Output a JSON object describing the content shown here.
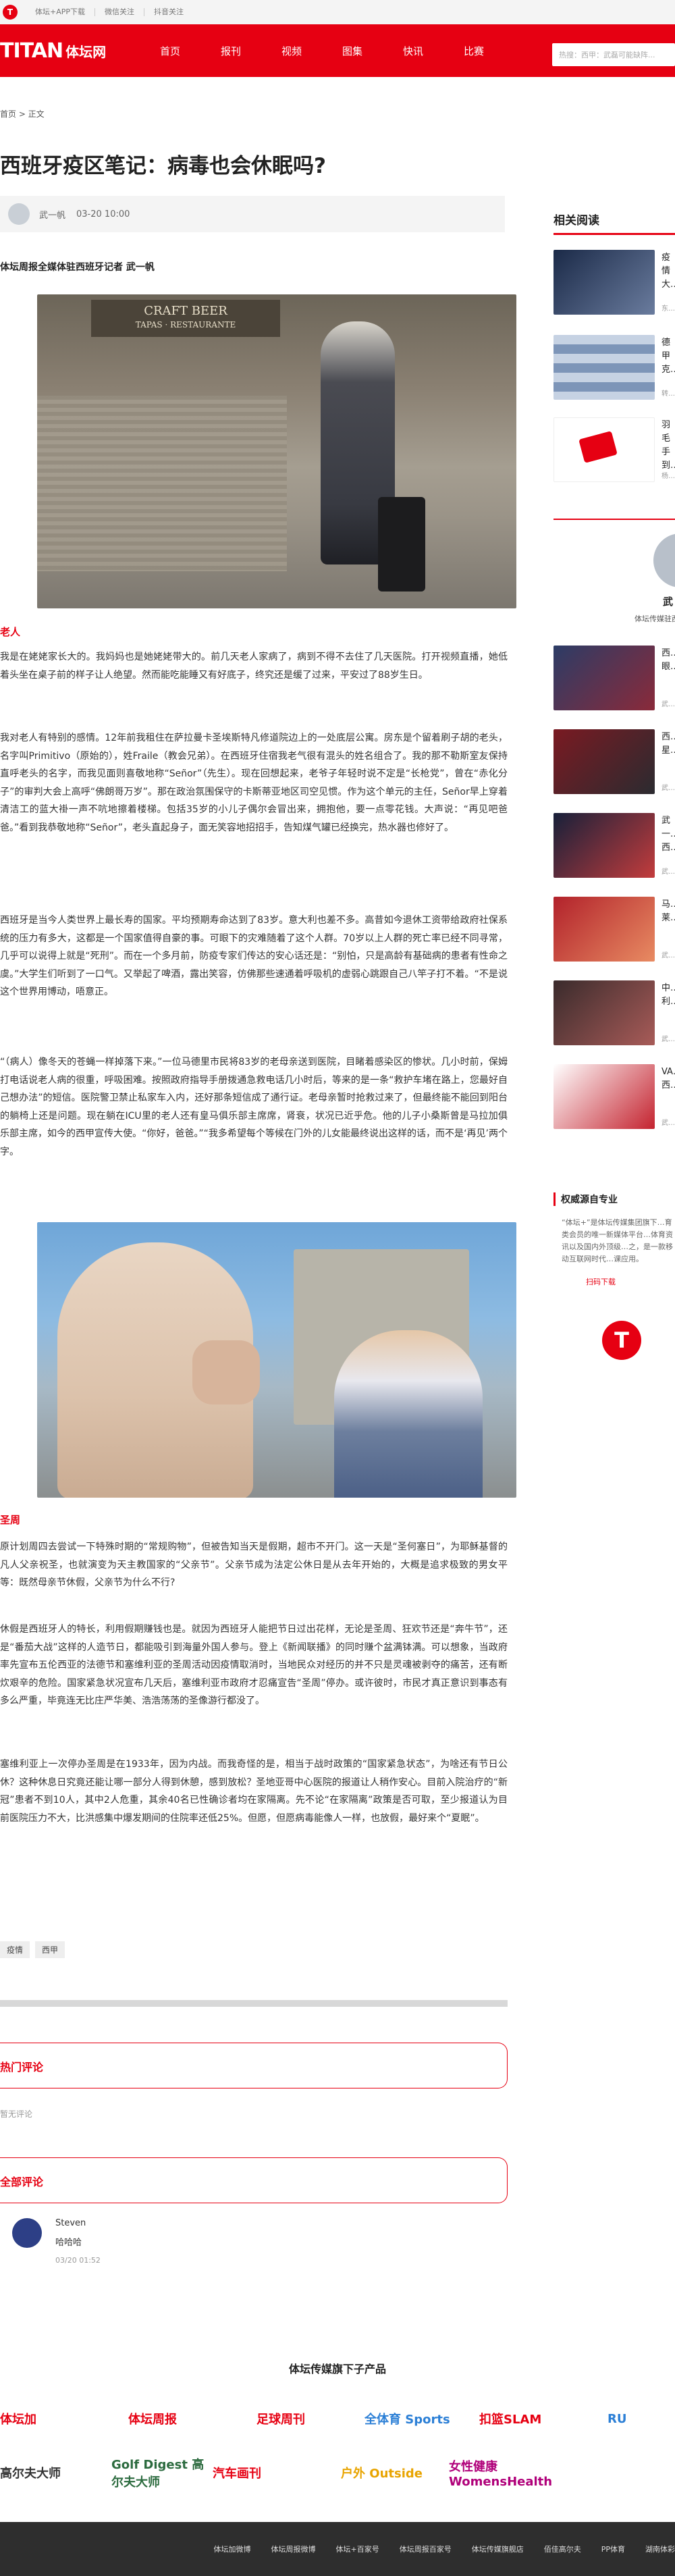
{
  "topbar": {
    "links": [
      "体坛+APP下载",
      "微信关注",
      "抖音关注"
    ]
  },
  "nav": {
    "brand": "TITAN",
    "brand_cn": "体坛网",
    "items": [
      "首页",
      "报刊",
      "视频",
      "图集",
      "快讯",
      "比赛"
    ],
    "search_placeholder": "热搜：西甲：武磊可能缺阵..."
  },
  "breadcrumb": "首页 > 正文",
  "article": {
    "title": "西班牙疫区笔记：病毒也会休眠吗?",
    "author": "武一帆",
    "date": "03-20 10:00",
    "lead": "体坛周报全媒体驻西班牙记者 武一帆",
    "photo1_sign": "CRAFT BEER",
    "photo1_sign2": "TAPAS · RESTAURANTE",
    "sections": [
      {
        "heading": "老人",
        "paragraphs": [
          "我是在姥姥家长大的。我妈妈也是她姥姥带大的。前几天老人家病了，病到不得不去住了几天医院。打开视频直播，她低着头坐在桌子前的样子让人绝望。然而能吃能睡又有好底子，终究还是缓了过来，平安过了88岁生日。",
          "我对老人有特别的感情。12年前我租住在萨拉曼卡圣埃斯特凡修道院边上的一处底层公寓。房东是个留着刷子胡的老头，名字叫Primitivo（原始的），姓Fraile（教会兄弟）。在西班牙住宿我老气很有混头的姓名组合了。我的那不勒斯室友保持直呼老头的名字，而我见面则喜敬地称“Señor”（先生）。现在回想起来，老爷子年轻时说不定是“长枪党”，曾在“赤化分子”的审判大会上高呼“佛朗哥万岁”。那在政治氛围保守的卡斯蒂亚地区司空见惯。作为这个单元的主任，Señor早上穿着清洁工的蓝大褂一声不吭地擦着楼梯。包括35岁的小儿子偶尔会冒出来，拥抱他，要一点零花钱。大声说：“再见吧爸爸。”看到我恭敬地称“Señor”，老头直起身子，面无笑容地招招手，告知煤气罐已经换完，热水器也修好了。",
          "西班牙是当今人类世界上最长寿的国家。平均预期寿命达到了83岁。意大利也差不多。高昔如今退休工资带给政府社保系统的压力有多大，这都是一个国家值得自豪的事。可眼下的灾难随着了这个人群。70岁以上人群的死亡率已经不同寻常，几乎可以说得上就是“死刑”。而在一个多月前，防疫专家们传达的安心话还是：“别怕，只是高龄有基础病的患者有性命之虞。”大学生们听到了一口气。又举起了啤酒，露出笑容，仿佛那些速通着呼吸机的虚弱心跳跟自己八竿子打不着。“不是说这个世界用博动，唔意正。",
          "“（病人）像冬天的苍蝇一样掉落下来。”一位马德里市民将83岁的老母亲送到医院，目睹着感染区的惨状。几小时前，保姆打电话说老人病的很重，呼吸困难。按照政府指导手册拨通急救电话几小时后，等来的是一条“救护车堵在路上，您最好自己想办法”的短信。医院警卫禁止私家车入内，还好那条短信成了通行证。老母亲暂时抢救过来了，但最终能不能回到阳台的躺椅上还是问题。现在躺在ICU里的老人还有皇马俱乐部主席席，肾衰，状况已近乎危。他的儿子小桑斯曾是马拉加俱乐部主席，如今的西甲宣传大使。“你好，爸爸。”“我多希望每个等候在门外的儿女能最终说出这样的话，而不是‘再见’两个字。"
        ]
      },
      {
        "heading": "圣周",
        "paragraphs": [
          "原计划周四去尝试一下特殊时期的“常规购物”，但被告知当天是假期，超市不开门。这一天是“圣何塞日”，为耶稣基督的凡人父亲祝圣，也就演变为天主教国家的“父亲节”。父亲节成为法定公休日是从去年开始的，大概是追求极致的男女平等：既然母亲节休假，父亲节为什么不行?",
          "休假是西班牙人的特长，利用假期赚钱也是。就因为西班牙人能把节日过出花样，无论是圣周、狂欢节还是“奔牛节”，还是“番茄大战”这样的人造节日，都能吸引到海量外国人参与。登上《新闻联播》的同时赚个盆满钵满。可以想象，当政府率先宣布五伦西亚的法德节和塞维利亚的圣周活动因疫情取消时，当地民众对经历的并不只是灵魂被剥夺的痛苦，还有断炊艰辛的危险。国家紧急状况宣布几天后，塞维利亚市政府才忍痛宣告“圣周”停办。或许彼时，市民才真正意识到事态有多么严重，毕竟连无比庄严华美、浩浩荡荡的圣像游行都没了。",
          "塞维利亚上一次停办圣周是在1933年，因为内战。而我奇怪的是，相当于战时政策的“国家紧急状态”，为啥还有节日公休？这种休息日究竟还能让哪一部分人得到休憩，感到放松？圣地亚哥中心医院的报道让人稍作安心。目前入院治疗的“新冠”患者不到10人，其中2人危重，其余40名已性确诊者均在家隔离。先不论“在家隔离”政策是否可取，至少报道认为目前医院压力不大，比洪感集中爆发期间的住院率还低25%。但愿，但愿病毒能像人一样，也放假，最好来个“夏眠”。"
        ]
      }
    ],
    "tags": [
      "疫情",
      "西甲"
    ]
  },
  "comments": {
    "hot_title": "热门评论",
    "hot_empty": "暂无评论",
    "all_title": "全部评论",
    "items": [
      {
        "user": "Steven",
        "text": "哈哈哈",
        "time": "03/20 01:52"
      }
    ]
  },
  "sidebar": {
    "related_title": "相关阅读",
    "related": [
      {
        "title": "疫情大…",
        "date": "东…"
      },
      {
        "title": "德甲克…",
        "date": "转…"
      },
      {
        "title": "羽毛手到…",
        "date": "杨…"
      }
    ],
    "author_name": "武",
    "author_desc": "体坛传媒驻西",
    "author_posts": [
      {
        "title": "西…眼…",
        "date": "武…"
      },
      {
        "title": "西…星…",
        "date": "武…"
      },
      {
        "title": "武一…西…",
        "date": "武…"
      },
      {
        "title": "马…莱…",
        "date": "武…"
      },
      {
        "title": "中…利…",
        "date": "武…"
      },
      {
        "title": "VA…西…",
        "date": "武…"
      }
    ],
    "authority_title": "权威源自专业",
    "authority_body": "“体坛+”是体坛传媒集团旗下…育类会员的唯一新媒体平台…体育资讯以及国内外顶级…之，是一款移动互联网时代…课应用。",
    "authority_link": "扫码下载",
    "authority_logo": "T"
  },
  "brands": {
    "title": "体坛传媒旗下子产品",
    "row1": [
      {
        "name": "体坛加",
        "color": "#e60012"
      },
      {
        "name": "体坛周报",
        "color": "#e60012"
      },
      {
        "name": "足球周刊",
        "color": "#e60012"
      },
      {
        "name": "全体育 Sports",
        "color": "#2b7fd6"
      },
      {
        "name": "扣篮SLAM",
        "color": "#e60012"
      },
      {
        "name": "RU",
        "color": "#2b7fd6"
      }
    ],
    "row2": [
      {
        "name": "高尔夫大师",
        "color": "#333333"
      },
      {
        "name": "Golf Digest 高尔夫大师",
        "color": "#2c6b3f"
      },
      {
        "name": "汽车画刊",
        "color": "#e60012"
      },
      {
        "name": "户外 Outside",
        "color": "#e8a400"
      },
      {
        "name": "女性健康 WomensHealth",
        "color": "#b0007a"
      }
    ]
  },
  "footer": {
    "links": [
      "体坛加微博",
      "体坛周报微博",
      "体坛+百家号",
      "体坛周报百家号",
      "体坛传媒旗舰店",
      "佰佳高尔夫",
      "PP体育",
      "湖南体彩"
    ]
  }
}
